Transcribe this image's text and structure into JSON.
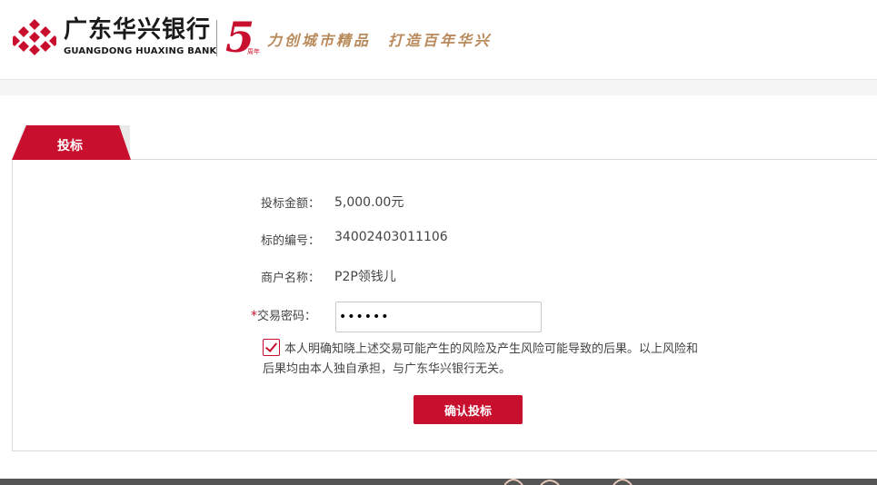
{
  "header": {
    "bank_name_cn": "广东华兴银行",
    "bank_name_en": "GUANGDONG HUAXING BANK",
    "anniversary": "5",
    "anniversary_suffix": "周年",
    "slogan": "力创城市精品　打造百年华兴",
    "brand_color": "#c8102e"
  },
  "tab": {
    "label": "投标"
  },
  "form": {
    "amount_label": "投标金额：",
    "amount_value": "5,000.00元",
    "bid_no_label": "标的编号：",
    "bid_no_value": "34002403011106",
    "merchant_label": "商户名称：",
    "merchant_value": "P2P领钱儿",
    "password_required_mark": "*",
    "password_label": "交易密码：",
    "password_value": "••••••",
    "agree_checked": true,
    "agree_text": "本人明确知晓上述交易可能产生的风险及产生风险可能导致的后果。以上风险和后果均由本人独自承担，与广东华兴银行无关。",
    "confirm_label": "确认投标"
  }
}
